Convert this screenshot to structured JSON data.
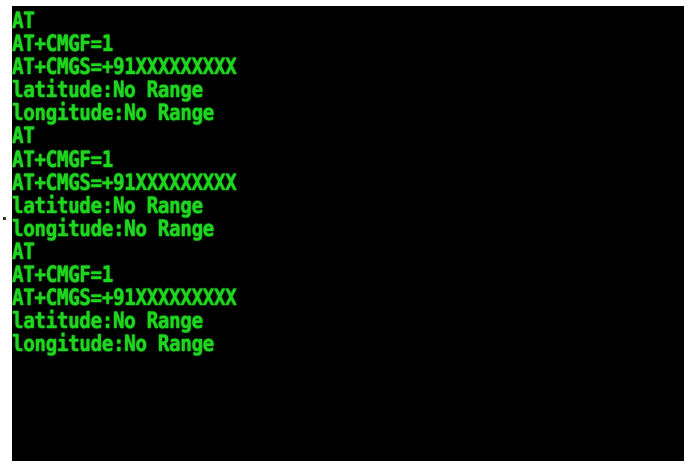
{
  "terminal": {
    "text_color": "#1fd61f",
    "background": "#000000",
    "lines": [
      "AT",
      "AT+CMGF=1",
      "AT+CMGS=+91XXXXXXXXX",
      "latitude:No Range",
      "longitude:No Range",
      "AT",
      "AT+CMGF=1",
      "AT+CMGS=+91XXXXXXXXX",
      "latitude:No Range",
      "longitude:No Range",
      "AT",
      "AT+CMGF=1",
      "AT+CMGS=+91XXXXXXXXX",
      "latitude:No Range",
      "longitude:No Range"
    ]
  }
}
